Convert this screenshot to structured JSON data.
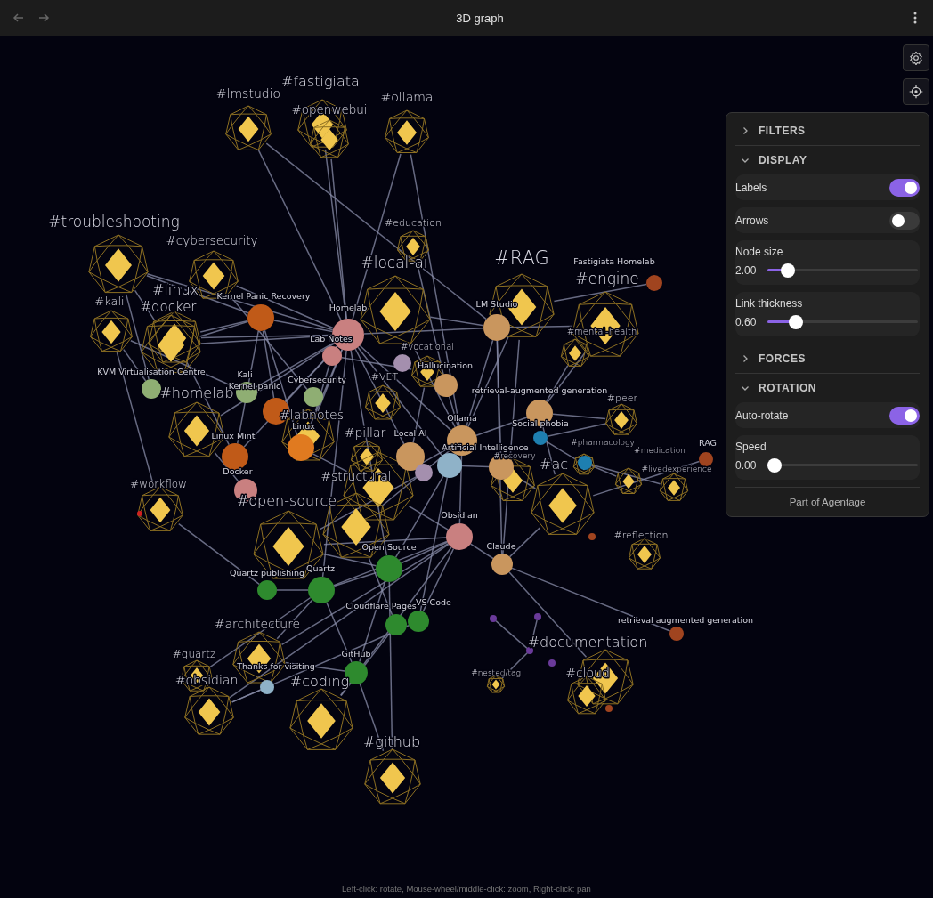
{
  "window": {
    "title": "3D graph"
  },
  "graph": {
    "nodes": [
      {
        "kind": "tag",
        "label": "#lmstudio"
      },
      {
        "kind": "tag",
        "label": "#fastigiata"
      },
      {
        "kind": "tag",
        "label": "#openwebui"
      },
      {
        "kind": "tag",
        "label": "#ollama"
      },
      {
        "kind": "tag",
        "label": "#troubleshooting"
      },
      {
        "kind": "tag",
        "label": "#cybersecurity"
      },
      {
        "kind": "tag",
        "label": "#education"
      },
      {
        "kind": "tag",
        "label": "#local-ai"
      },
      {
        "kind": "tag",
        "label": "#RAG"
      },
      {
        "kind": "tag",
        "label": "#engine"
      },
      {
        "kind": "tag",
        "label": "#linux"
      },
      {
        "kind": "tag",
        "label": "#docker"
      },
      {
        "kind": "tag",
        "label": "#kali"
      },
      {
        "kind": "tag",
        "label": "#mental-health"
      },
      {
        "kind": "tag",
        "label": "#vocational"
      },
      {
        "kind": "tag",
        "label": "#VET"
      },
      {
        "kind": "tag",
        "label": "#homelab"
      },
      {
        "kind": "tag",
        "label": "#labnotes"
      },
      {
        "kind": "tag",
        "label": "#peer"
      },
      {
        "kind": "tag",
        "label": "#pillar"
      },
      {
        "kind": "tag",
        "label": "#structural"
      },
      {
        "kind": "tag",
        "label": "#open-source"
      },
      {
        "kind": "tag"
      },
      {
        "kind": "tag",
        "label": "#workflow"
      },
      {
        "kind": "tag",
        "label": "#ac"
      },
      {
        "kind": "tag",
        "label": "#medication"
      },
      {
        "kind": "tag",
        "label": "#livedexperience"
      },
      {
        "kind": "tag",
        "label": "#pharmacology"
      },
      {
        "kind": "tag",
        "label": "#recovery"
      },
      {
        "kind": "tag",
        "label": "#reflection"
      },
      {
        "kind": "tag",
        "label": "#architecture"
      },
      {
        "kind": "tag",
        "label": "#quartz"
      },
      {
        "kind": "tag",
        "label": "#obsidian"
      },
      {
        "kind": "tag",
        "label": "#coding"
      },
      {
        "kind": "tag",
        "label": "#github"
      },
      {
        "kind": "tag",
        "label": "#documentation"
      },
      {
        "kind": "tag",
        "label": "#nested/tag"
      },
      {
        "kind": "tag",
        "label": "#cloud"
      },
      {
        "kind": "note",
        "label": "Kernel Panic Recovery",
        "color": "#c05a18"
      },
      {
        "kind": "note",
        "label": "Homelab",
        "color": "#c98080"
      },
      {
        "kind": "note",
        "label": "Lab Notes",
        "color": "#c98080"
      },
      {
        "kind": "note",
        "color": "#a48fae"
      },
      {
        "kind": "note",
        "label": "Hallucination",
        "color": "#c9965e"
      },
      {
        "kind": "note",
        "label": "LM Studio",
        "color": "#c9965e"
      },
      {
        "kind": "note",
        "label": "retrieval-augmented generation",
        "color": "#c9965e"
      },
      {
        "kind": "note",
        "label": "Ollama",
        "color": "#c9965e"
      },
      {
        "kind": "note",
        "label": "Local AI",
        "color": "#c9965e"
      },
      {
        "kind": "note",
        "label": "Artificial Intelligence",
        "color": "#8fb2c8"
      },
      {
        "kind": "note",
        "color": "#a48fae"
      },
      {
        "kind": "note",
        "color": "#c9965e"
      },
      {
        "kind": "note",
        "label": "Social phobia",
        "color": "#1e7fb0"
      },
      {
        "kind": "note",
        "color": "#1e7fb0"
      },
      {
        "kind": "note",
        "label": "RAG",
        "color": "#a0441f"
      },
      {
        "kind": "note",
        "label": "Fastigiata Homelab",
        "color": "#a0441f"
      },
      {
        "kind": "note",
        "label": "KVM Virtualisation Centre",
        "color": "#8fae73"
      },
      {
        "kind": "note",
        "label": "Kali",
        "color": "#8fae73"
      },
      {
        "kind": "note",
        "label": "Kernel panic",
        "color": "#c05a18"
      },
      {
        "kind": "note",
        "label": "Cybersecurity",
        "color": "#8fae73"
      },
      {
        "kind": "note",
        "label": "Linux",
        "color": "#e07a20"
      },
      {
        "kind": "note",
        "label": "Linux Mint",
        "color": "#c05a18"
      },
      {
        "kind": "note",
        "label": "Docker",
        "color": "#c98080"
      },
      {
        "kind": "note",
        "label": "Obsidian",
        "color": "#c98080"
      },
      {
        "kind": "note",
        "label": "Claude",
        "color": "#c9965e"
      },
      {
        "kind": "note",
        "label": "Open Source",
        "color": "#2e8a2e"
      },
      {
        "kind": "note",
        "label": "Quartz",
        "color": "#2e8a2e"
      },
      {
        "kind": "note",
        "label": "Quartz publishing",
        "color": "#2e8a2e"
      },
      {
        "kind": "note",
        "label": "Cloudflare Pages",
        "color": "#2e8a2e"
      },
      {
        "kind": "note",
        "label": "VS Code",
        "color": "#2e8a2e"
      },
      {
        "kind": "note",
        "label": "GitHub",
        "color": "#2e8a2e"
      },
      {
        "kind": "note",
        "label": "Thanks for visiting",
        "color": "#8fb2c8"
      },
      {
        "kind": "note",
        "label": "retrieval augmented generation",
        "color": "#a0441f"
      },
      {
        "kind": "note",
        "color": "#6a3a9a"
      },
      {
        "kind": "note",
        "color": "#6a3a9a"
      },
      {
        "kind": "note",
        "color": "#6a3a9a"
      },
      {
        "kind": "note",
        "color": "#6a3a9a"
      },
      {
        "kind": "note",
        "color": "#d02020"
      },
      {
        "kind": "note",
        "color": "#a0441f"
      },
      {
        "kind": "note",
        "color": "#a0441f"
      }
    ]
  },
  "panel": {
    "sections": [
      {
        "title": "FILTERS",
        "expanded": false
      },
      {
        "title": "DISPLAY",
        "expanded": true,
        "controls": [
          {
            "kind": "toggle",
            "label": "Labels",
            "on": true
          },
          {
            "kind": "toggle",
            "label": "Arrows",
            "on": false
          },
          {
            "kind": "slider",
            "label": "Node size",
            "reading": "2.00",
            "level": 0.1
          },
          {
            "kind": "slider",
            "label": "Link thickness",
            "reading": "0.60",
            "level": 0.16
          }
        ]
      },
      {
        "title": "FORCES",
        "expanded": false
      },
      {
        "title": "ROTATION",
        "expanded": true,
        "controls": [
          {
            "kind": "toggle",
            "label": "Auto-rotate",
            "on": true
          },
          {
            "kind": "slider",
            "label": "Speed",
            "reading": "0.00",
            "level": 0
          }
        ]
      }
    ],
    "footer": "Part of Agentage"
  },
  "hint": "Left-click: rotate, Mouse-wheel/middle-click: zoom, Right-click: pan"
}
